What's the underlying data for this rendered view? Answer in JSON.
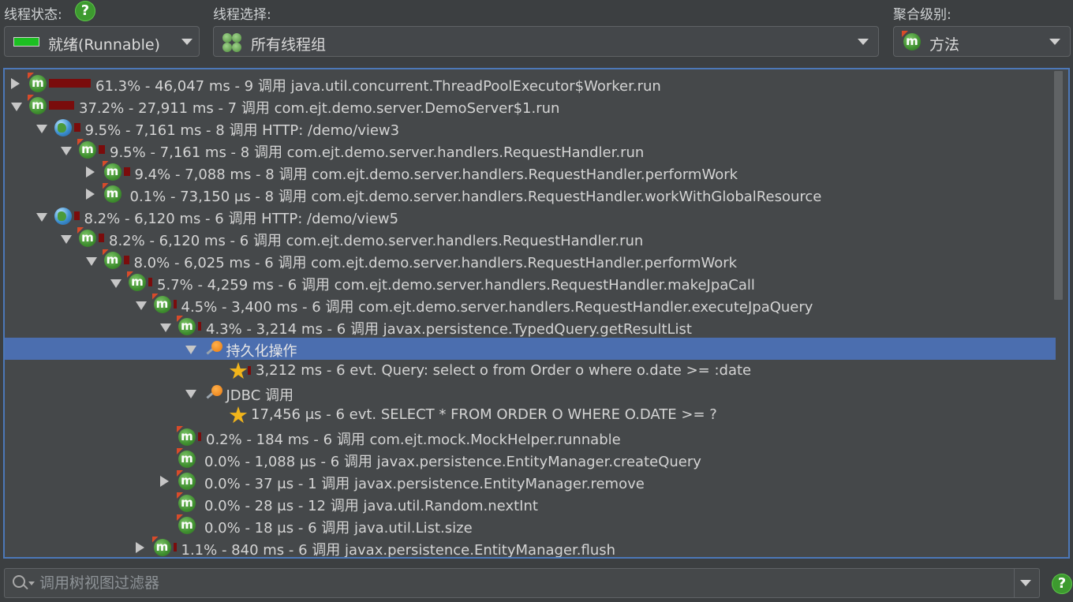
{
  "toolbar": {
    "thread_state_label": "线程状态:",
    "thread_state_value": "就绪(Runnable)",
    "thread_select_label": "线程选择:",
    "thread_select_value": "所有线程组",
    "aggregation_label": "聚合级别:",
    "aggregation_value": "方法",
    "help_glyph": "?"
  },
  "colors": {
    "accent": "#4b6eaf",
    "runnable": "#1cbf22",
    "bar": "#7a0c0c"
  },
  "tree": {
    "rows": [
      {
        "text": "61.3% - 46,047 ms - 9 调用 java.util.concurrent.ThreadPoolExecutor$Worker.run",
        "depth": 0,
        "toggle": "collapsed",
        "icon": "method",
        "fraction": 0.613
      },
      {
        "text": "37.2% - 27,911 ms - 7 调用 com.ejt.demo.server.DemoServer$1.run",
        "depth": 0,
        "toggle": "expanded",
        "icon": "method",
        "fraction": 0.372
      },
      {
        "text": "9.5% - 7,161 ms - 8 调用 HTTP: /demo/view3",
        "depth": 1,
        "toggle": "expanded",
        "icon": "http",
        "fraction": 0.095
      },
      {
        "text": "9.5% - 7,161 ms - 8 调用 com.ejt.demo.server.handlers.RequestHandler.run",
        "depth": 2,
        "toggle": "expanded",
        "icon": "method",
        "fraction": 0.095
      },
      {
        "text": "9.4% - 7,088 ms - 8 调用 com.ejt.demo.server.handlers.RequestHandler.performWork",
        "depth": 3,
        "toggle": "collapsed",
        "icon": "method",
        "fraction": 0.094
      },
      {
        "text": "0.1% - 73,150 μs - 8 调用 com.ejt.demo.server.handlers.RequestHandler.workWithGlobalResource",
        "depth": 3,
        "toggle": "collapsed",
        "icon": "method",
        "fraction": 0.001
      },
      {
        "text": "8.2% - 6,120 ms - 6 调用 HTTP: /demo/view5",
        "depth": 1,
        "toggle": "expanded",
        "icon": "http",
        "fraction": 0.082
      },
      {
        "text": "8.2% - 6,120 ms - 6 调用 com.ejt.demo.server.handlers.RequestHandler.run",
        "depth": 2,
        "toggle": "expanded",
        "icon": "method",
        "fraction": 0.082
      },
      {
        "text": "8.0% - 6,025 ms - 6 调用 com.ejt.demo.server.handlers.RequestHandler.performWork",
        "depth": 3,
        "toggle": "expanded",
        "icon": "method",
        "fraction": 0.08
      },
      {
        "text": "5.7% - 4,259 ms - 6 调用 com.ejt.demo.server.handlers.RequestHandler.makeJpaCall",
        "depth": 4,
        "toggle": "expanded",
        "icon": "method",
        "fraction": 0.057
      },
      {
        "text": "4.5% - 3,400 ms - 6 调用 com.ejt.demo.server.handlers.RequestHandler.executeJpaQuery",
        "depth": 5,
        "toggle": "expanded",
        "icon": "method",
        "fraction": 0.045
      },
      {
        "text": "4.3% - 3,214 ms - 6 调用 javax.persistence.TypedQuery.getResultList",
        "depth": 6,
        "toggle": "expanded",
        "icon": "method",
        "fraction": 0.043
      },
      {
        "text": "持久化操作",
        "depth": 7,
        "toggle": "expanded",
        "icon": "probe",
        "fraction": 0,
        "selected": true
      },
      {
        "text": "3,212 ms - 6 evt. Query: select o from Order o where o.date >= :date",
        "depth": 8,
        "toggle": "none",
        "icon": "event",
        "fraction": 0.043
      },
      {
        "text": "JDBC 调用",
        "depth": 7,
        "toggle": "expanded",
        "icon": "probe",
        "fraction": 0
      },
      {
        "text": "17,456 μs - 6 evt. SELECT * FROM ORDER O WHERE O.DATE >= ?",
        "depth": 8,
        "toggle": "none",
        "icon": "event",
        "fraction": 0
      },
      {
        "text": "0.2% - 184 ms - 6 调用 com.ejt.mock.MockHelper.runnable",
        "depth": 6,
        "toggle": "none",
        "icon": "method",
        "fraction": 0.002
      },
      {
        "text": "0.0% - 1,088 μs - 6 调用 javax.persistence.EntityManager.createQuery",
        "depth": 6,
        "toggle": "none",
        "icon": "method",
        "fraction": 0
      },
      {
        "text": "0.0% - 37 μs - 1 调用 javax.persistence.EntityManager.remove",
        "depth": 6,
        "toggle": "collapsed",
        "icon": "method",
        "fraction": 0
      },
      {
        "text": "0.0% - 28 μs - 12 调用 java.util.Random.nextInt",
        "depth": 6,
        "toggle": "none",
        "icon": "method",
        "fraction": 0
      },
      {
        "text": "0.0% - 18 μs - 6 调用 java.util.List.size",
        "depth": 6,
        "toggle": "none",
        "icon": "method",
        "fraction": 0
      },
      {
        "text": "1.1% - 840 ms - 6 调用 javax.persistence.EntityManager.flush",
        "depth": 5,
        "toggle": "collapsed",
        "icon": "method",
        "fraction": 0.011
      }
    ]
  },
  "filter": {
    "placeholder": "调用树视图过滤器",
    "value": ""
  }
}
